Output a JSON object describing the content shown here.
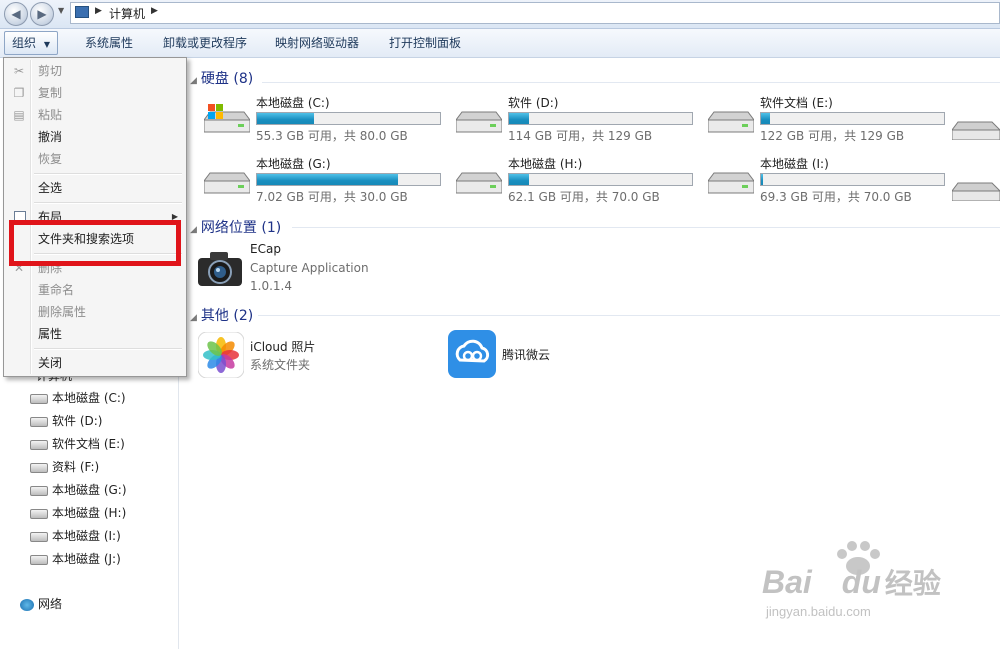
{
  "address": {
    "crumb": "计算机"
  },
  "toolbar": {
    "organize": "组织",
    "system_properties": "系统属性",
    "uninstall": "卸载或更改程序",
    "map_drive": "映射网络驱动器",
    "control_panel": "打开控制面板"
  },
  "menu": {
    "items": [
      {
        "label": "剪切"
      },
      {
        "label": "复制"
      },
      {
        "label": "粘贴"
      },
      {
        "label": "撤消"
      },
      {
        "label": "恢复"
      },
      {
        "label": "全选"
      },
      {
        "label": "布局"
      },
      {
        "label": "文件夹和搜索选项"
      },
      {
        "label": "删除"
      },
      {
        "label": "重命名"
      },
      {
        "label": "删除属性"
      },
      {
        "label": "属性"
      },
      {
        "label": "关闭"
      }
    ]
  },
  "nav": {
    "computer": "计算机",
    "drives": [
      "本地磁盘 (C:)",
      "软件 (D:)",
      "软件文档 (E:)",
      "资料 (F:)",
      "本地磁盘 (G:)",
      "本地磁盘 (H:)",
      "本地磁盘 (I:)",
      "本地磁盘 (J:)"
    ],
    "network": "网络"
  },
  "groups": {
    "hdd": "硬盘 (8)",
    "network": "网络位置 (1)",
    "other": "其他 (2)"
  },
  "drives": [
    {
      "name": "本地磁盘 (C:)",
      "info": "55.3 GB 可用，共 80.0 GB",
      "used_fraction": 0.31
    },
    {
      "name": "软件 (D:)",
      "info": "114 GB 可用，共 129 GB",
      "used_fraction": 0.11
    },
    {
      "name": "软件文档 (E:)",
      "info": "122 GB 可用，共 129 GB",
      "used_fraction": 0.05
    },
    {
      "name": "本地磁盘 (G:)",
      "info": "7.02 GB 可用，共 30.0 GB",
      "used_fraction": 0.77
    },
    {
      "name": "本地磁盘 (H:)",
      "info": "62.1 GB 可用，共 70.0 GB",
      "used_fraction": 0.11
    },
    {
      "name": "本地磁盘 (I:)",
      "info": "69.3 GB 可用，共 70.0 GB",
      "used_fraction": 0.01
    }
  ],
  "ecap": {
    "name": "ECap",
    "desc": "Capture Application",
    "version": "1.0.1.4"
  },
  "icloud": {
    "name": "iCloud 照片",
    "desc": "系统文件夹"
  },
  "weiyun": {
    "name": "腾讯微云"
  },
  "watermark": {
    "brand": "Bai",
    "du": "du",
    "cn": "经验",
    "url": "jingyan.baidu.com"
  },
  "colors": {
    "highlight": "#e0141a",
    "progress": "#1a8fc0",
    "group_header": "#1e3287"
  }
}
